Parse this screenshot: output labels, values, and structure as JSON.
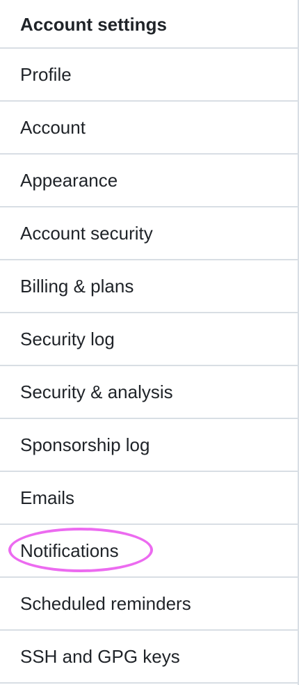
{
  "sidebar": {
    "title": "Account settings",
    "items": [
      {
        "label": "Profile"
      },
      {
        "label": "Account"
      },
      {
        "label": "Appearance"
      },
      {
        "label": "Account security"
      },
      {
        "label": "Billing & plans"
      },
      {
        "label": "Security log"
      },
      {
        "label": "Security & analysis"
      },
      {
        "label": "Sponsorship log"
      },
      {
        "label": "Emails"
      },
      {
        "label": "Notifications",
        "highlighted": true
      },
      {
        "label": "Scheduled reminders"
      },
      {
        "label": "SSH and GPG keys"
      }
    ]
  },
  "colors": {
    "text": "#1f2328",
    "divider": "#d8dee4",
    "highlight": "#ec6bf0",
    "background": "#ffffff"
  }
}
